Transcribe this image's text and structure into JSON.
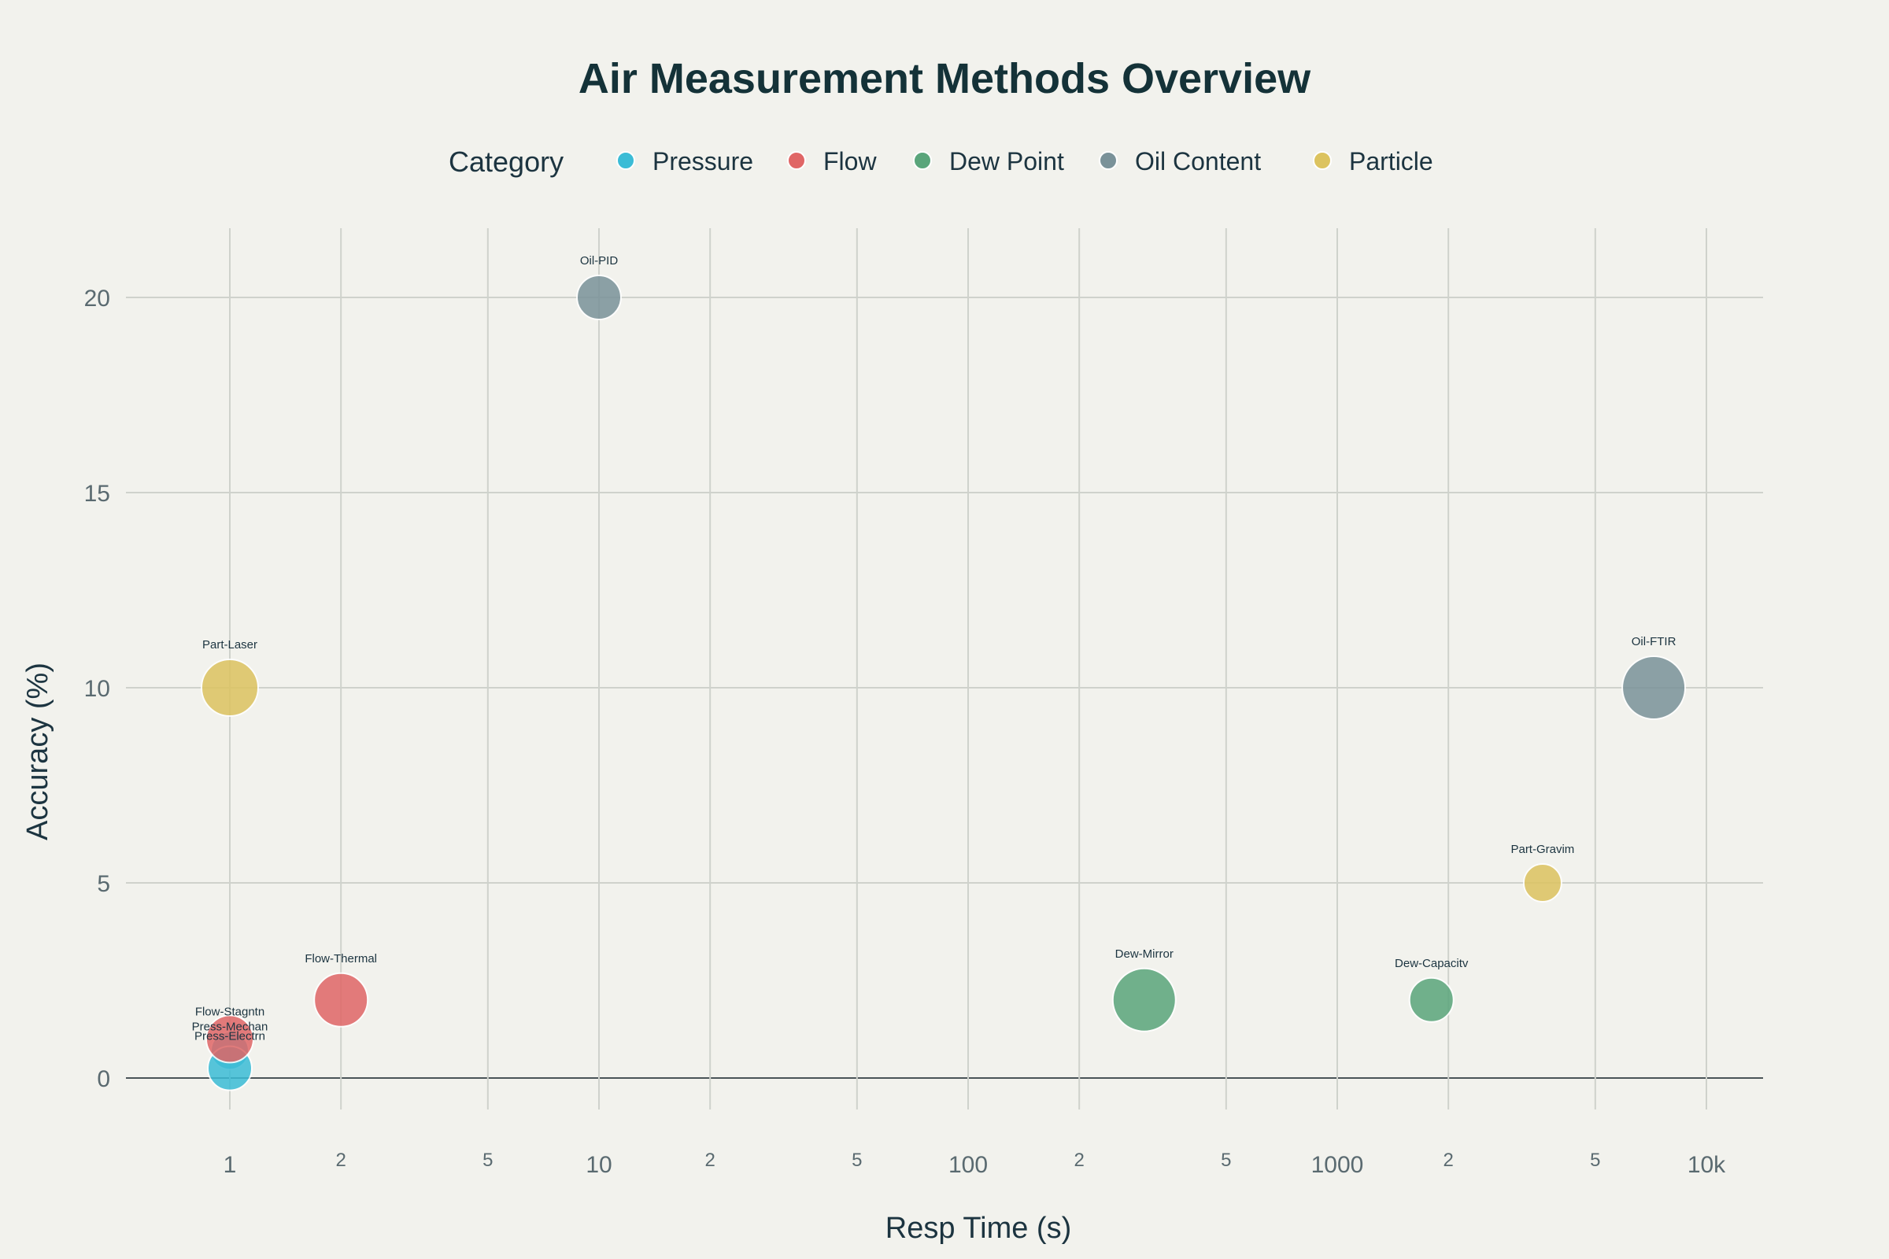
{
  "chart_data": {
    "type": "scatter",
    "title": "Air Measurement Methods Overview",
    "xlabel": "Resp Time (s)",
    "ylabel": "Accuracy (%)",
    "x_scale": "log",
    "xlim": [
      0.5,
      15000
    ],
    "ylim": [
      -1.5,
      21.5
    ],
    "x_tick_values": [
      1,
      10,
      100,
      1000,
      10000
    ],
    "x_tick_labels": [
      "1",
      "10",
      "100",
      "1000",
      "10k"
    ],
    "x_minor_tick_labels": [
      "2",
      "5"
    ],
    "y_tick_values": [
      0,
      5,
      10,
      15,
      20
    ],
    "y_tick_labels": [
      "0",
      "5",
      "10",
      "15",
      "20"
    ],
    "grid": true,
    "legend": {
      "title": "Category",
      "position": "top-center"
    },
    "series": [
      {
        "name": "Pressure",
        "color": "#3bbcd6",
        "points": [
          {
            "label": "Press-Mechan",
            "x": 1,
            "y": 0.7,
            "size": 24
          },
          {
            "label": "Press-Electrn",
            "x": 1,
            "y": 0.25,
            "size": 28
          }
        ]
      },
      {
        "name": "Flow",
        "color": "#e06666",
        "points": [
          {
            "label": "Flow-Stagntn",
            "x": 1,
            "y": 1,
            "size": 30
          },
          {
            "label": "Flow-Thermal",
            "x": 2,
            "y": 2,
            "size": 34
          }
        ]
      },
      {
        "name": "Dew Point",
        "color": "#5aa57b",
        "points": [
          {
            "label": "Dew-Mirror",
            "x": 300,
            "y": 2,
            "size": 40
          },
          {
            "label": "Dew-Capacitv",
            "x": 1800,
            "y": 2,
            "size": 28
          }
        ]
      },
      {
        "name": "Oil Content",
        "color": "#7a9299",
        "points": [
          {
            "label": "Oil-PID",
            "x": 10,
            "y": 20,
            "size": 28
          },
          {
            "label": "Oil-FTIR",
            "x": 7200,
            "y": 10,
            "size": 40
          }
        ]
      },
      {
        "name": "Particle",
        "color": "#dcc35f",
        "points": [
          {
            "label": "Part-Laser",
            "x": 1,
            "y": 10,
            "size": 36
          },
          {
            "label": "Part-Gravim",
            "x": 3600,
            "y": 5,
            "size": 24
          }
        ]
      }
    ]
  }
}
